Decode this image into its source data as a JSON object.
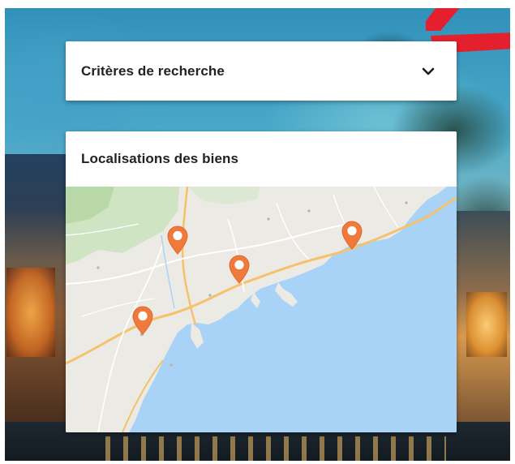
{
  "search_panel": {
    "title": "Critères de recherche",
    "toggle_icon": "chevron-down-icon"
  },
  "map_panel": {
    "title": "Localisations des biens",
    "pins": [
      {
        "name": "map-pin-grasse",
        "icon": "map-marker-icon"
      },
      {
        "name": "map-pin-nice",
        "icon": "map-marker-icon"
      },
      {
        "name": "map-pin-cannes",
        "icon": "map-marker-icon"
      },
      {
        "name": "map-pin-monaco",
        "icon": "map-marker-icon"
      }
    ]
  },
  "colors": {
    "pin": "#f07a3c",
    "sea": "#a8d3f7",
    "land": "#eceae4",
    "park": "#cfe4c2",
    "brand_red": "#e5202e"
  }
}
